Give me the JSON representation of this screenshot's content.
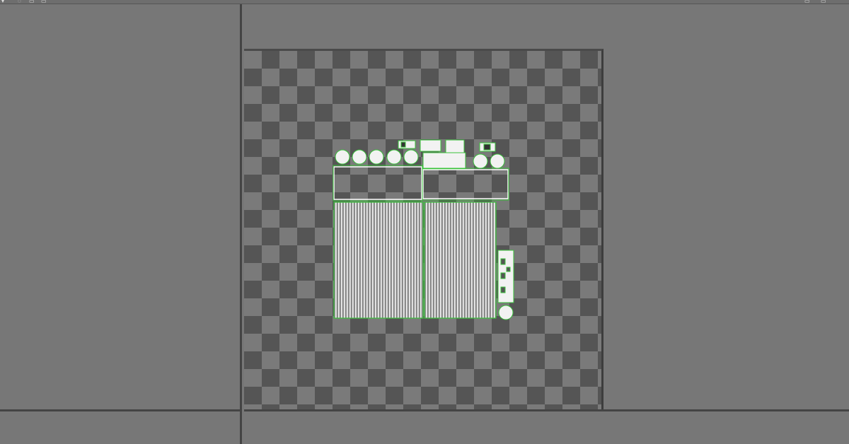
{
  "window": {
    "toolbar_icons": [
      "cursor-icon",
      "rotate-icon",
      "select-icon",
      "move-icon",
      "screen-icon",
      "layout-icon"
    ]
  },
  "viewport": {
    "canvas_pattern": "checkerboard",
    "uv_wire_color": "#39c23a",
    "uv_fill_color": "#f2f2f2"
  },
  "panels": {
    "left": "",
    "bottom_left": "",
    "bottom_right": ""
  }
}
